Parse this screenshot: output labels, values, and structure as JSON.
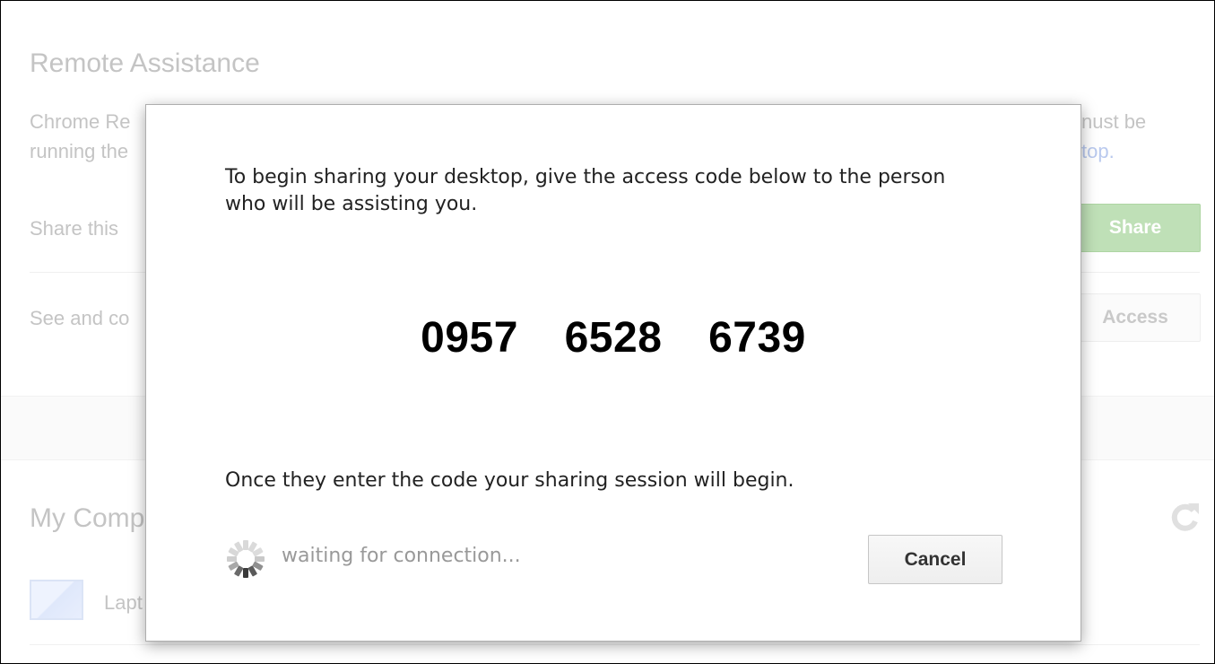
{
  "background": {
    "remote_assistance": {
      "title": "Remote Assistance",
      "desc_line1": "Chrome Re",
      "desc_line2": "running the",
      "desc_right_line1": "nust be",
      "desc_right_line2": "top.",
      "share_label": "Share this",
      "share_button": "Share",
      "see_label": "See and co",
      "access_button": "Access"
    },
    "my_computers": {
      "title": "My Comp",
      "computer_label": "Lapt"
    }
  },
  "dialog": {
    "intro": "To begin sharing your desktop, give the access code below to the person who will be assisting you.",
    "access_code": "0957  6528  6739",
    "outro": "Once they enter the code your sharing session will begin.",
    "status": "waiting for connection...",
    "cancel_button": "Cancel"
  },
  "colors": {
    "share_button_bg": "#bfe0b7",
    "dialog_border": "#aeaeae",
    "status_text": "#999999"
  },
  "icons": {
    "spinner": "loading-spinner-icon",
    "refresh": "refresh-icon",
    "computer": "computer-icon"
  }
}
